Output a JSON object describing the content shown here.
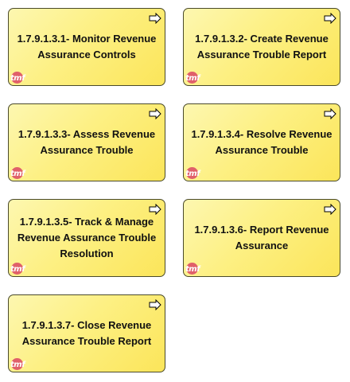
{
  "processes": [
    {
      "label": "1.7.9.1.3.1- Monitor Revenue\nAssurance Controls",
      "icon": "process-arrow-icon",
      "logo": "tmf"
    },
    {
      "label": "1.7.9.1.3.2- Create Revenue\nAssurance Trouble Report",
      "icon": "process-arrow-icon",
      "logo": "tmf"
    },
    {
      "label": "1.7.9.1.3.3- Assess Revenue\nAssurance Trouble",
      "icon": "process-arrow-icon",
      "logo": "tmf"
    },
    {
      "label": "1.7.9.1.3.4- Resolve Revenue\nAssurance Trouble",
      "icon": "process-arrow-icon",
      "logo": "tmf"
    },
    {
      "label": "1.7.9.1.3.5- Track & Manage\nRevenue Assurance Trouble\nResolution",
      "icon": "process-arrow-icon",
      "logo": "tmf"
    },
    {
      "label": "1.7.9.1.3.6- Report Revenue\nAssurance",
      "icon": "process-arrow-icon",
      "logo": "tmf"
    },
    {
      "label": "1.7.9.1.3.7- Close Revenue\nAssurance Trouble Report",
      "icon": "process-arrow-icon",
      "logo": "tmf"
    }
  ],
  "colors": {
    "box_fill": "#fdf083",
    "box_border": "#4a4a2a",
    "logo_circle": "#e0606a"
  }
}
